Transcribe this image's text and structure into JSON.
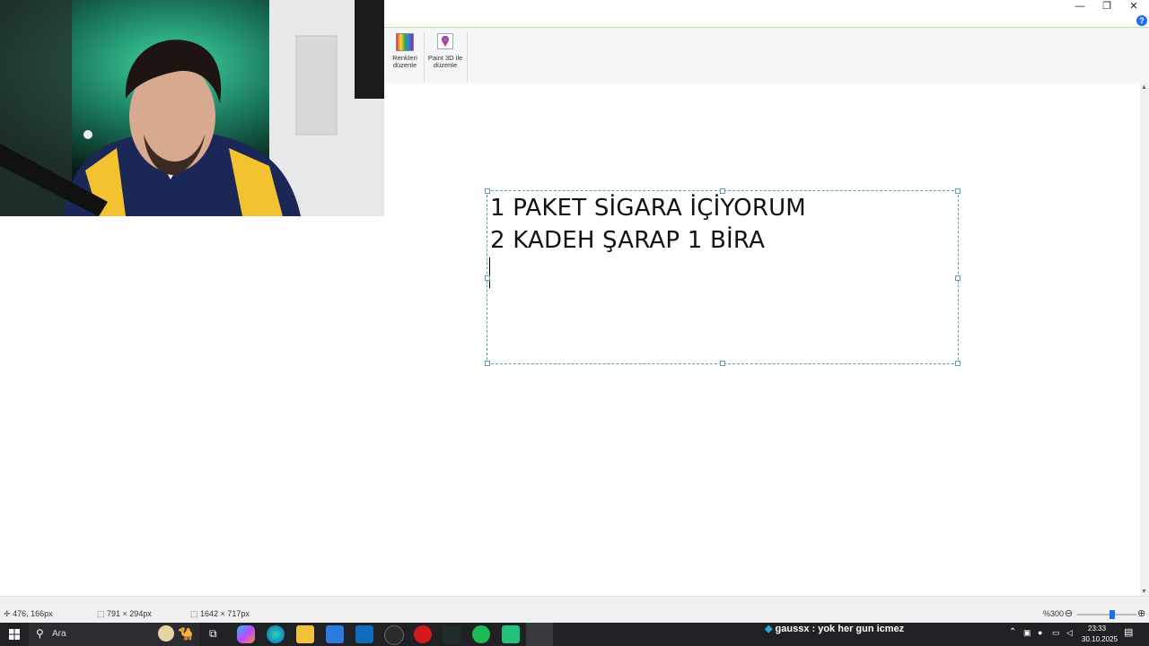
{
  "window": {
    "minimize_glyph": "—",
    "restore_glyph": "❐",
    "close_glyph": "✕",
    "help_glyph": "?"
  },
  "ribbon": {
    "edit_colors": {
      "line1": "Renkleri",
      "line2": "düzenle",
      "icon": "color-palette-icon"
    },
    "paint3d": {
      "line1": "Paint 3D ile",
      "line2": "düzenle",
      "icon": "paint3d-icon"
    }
  },
  "canvas": {
    "text_lines": [
      "1 PAKET SİGARA İÇİYORUM",
      "2 KADEH ŞARAP 1 BİRA"
    ]
  },
  "statusbar": {
    "cursor_position": "476, 166px",
    "selection_size": "791 × 294px",
    "image_size": "1642 × 717px",
    "zoom": "%300"
  },
  "taskbar": {
    "search_label": "Ara",
    "chat_message": "gaussx : yok her gun icmez",
    "time": "23:33",
    "date": "30.10.2025"
  },
  "colors": {
    "selection_border": "#5a9fb4",
    "ribbon_top_accent": "#b7dca5",
    "taskbar_bg": "#202124"
  }
}
